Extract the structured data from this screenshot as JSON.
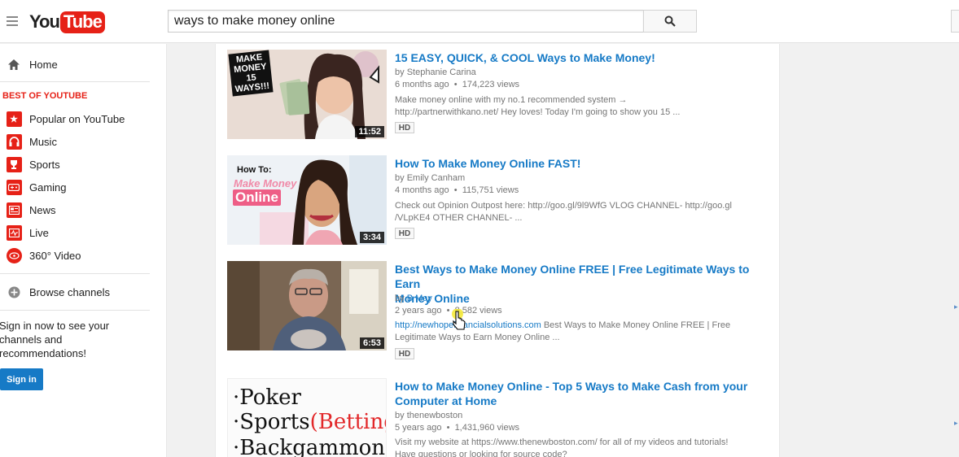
{
  "header": {
    "logo_you": "You",
    "logo_tube": "Tube",
    "search_value": "ways to make money online"
  },
  "sidebar": {
    "home_label": "Home",
    "section_title": "BEST OF YOUTUBE",
    "items": [
      {
        "label": "Popular on YouTube",
        "icon": "star-icon"
      },
      {
        "label": "Music",
        "icon": "headphones-icon"
      },
      {
        "label": "Sports",
        "icon": "trophy-icon"
      },
      {
        "label": "Gaming",
        "icon": "gamepad-icon"
      },
      {
        "label": "News",
        "icon": "newspaper-icon"
      },
      {
        "label": "Live",
        "icon": "live-icon"
      },
      {
        "label": "360° Video",
        "icon": "360-icon"
      }
    ],
    "browse_label": "Browse channels",
    "signin_text": "Sign in now to see your channels and recommendations!",
    "signin_button": "Sign in"
  },
  "results": [
    {
      "title": "15 EASY, QUICK, & COOL Ways to Make Money!",
      "by": "by ",
      "channel": "Stephanie Carina",
      "age": "6 months ago",
      "views": "174,223 views",
      "desc_line1": "Make money online with my no.1 recommended system →",
      "desc_line2": "http://partnerwithkano.net/ Hey loves! Today I'm going to show you 15 ...",
      "badge": "HD",
      "duration": "11:52",
      "thumb_text": "MAKE MONEY 15 WAYS!!!"
    },
    {
      "title": "How To Make Money Online FAST!",
      "by": "by ",
      "channel": "Emily Canham",
      "age": "4 months ago",
      "views": "115,751 views",
      "desc_line1": "Check out Opinion Outpost here: http://goo.gl/9l9WfG VLOG CHANNEL- http://goo.gl",
      "desc_line2": "/VLpKE4 OTHER CHANNEL- ...",
      "badge": "HD",
      "duration": "3:34",
      "thumb_text_1": "How To:",
      "thumb_text_2": "Make Money",
      "thumb_text_3": "Online"
    },
    {
      "title_line1": "Best Ways to Make Money Online FREE | Free Legitimate Ways to Earn",
      "title_line2": "Money Online",
      "by": "by ",
      "channel": "B May",
      "age": "2 years ago",
      "views": "8,582 views",
      "desc_link": "http://newhopefinancialsolutions.com",
      "desc_line1_rest": " Best Ways to Make Money Online FREE | Free",
      "desc_line2": "Legitimate Ways to Earn Money Online ...",
      "badge": "HD",
      "duration": "6:53"
    },
    {
      "title_line1": "How to Make Money Online - Top 5 Ways to Make Cash from your",
      "title_line2": "Computer at Home",
      "by": "by ",
      "channel": "thenewboston",
      "age": "5 years ago",
      "views": "1,431,960 views",
      "desc_line1": "Visit my website at https://www.thenewboston.com/ for all of my videos and tutorials!",
      "desc_line2": "Have questions or looking for source code?",
      "thumb_line1": "·Poker",
      "thumb_line2": "·Sports",
      "thumb_line2b": "(Betting)",
      "thumb_line3": "·Backgammon"
    }
  ],
  "colors": {
    "brand_red": "#e62117",
    "link_blue": "#167ac6",
    "meta_gray": "#767676"
  }
}
